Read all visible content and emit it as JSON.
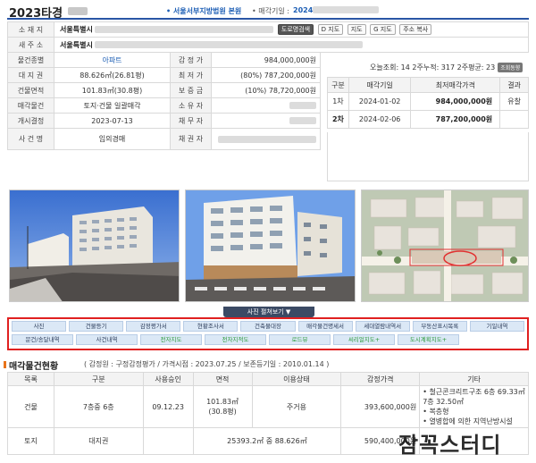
{
  "header": {
    "case_number": "2023타경",
    "court": "• 서울서부지방법원 본원",
    "sale_date_label": "• 매각기일 :",
    "sale_date_value": "2024."
  },
  "info": {
    "location_label": "소 재 지",
    "location_value": "서울특별시",
    "buttons": [
      "도로명검색",
      "D 지도",
      "지도",
      "G 지도",
      "주소 복사"
    ],
    "new_address_label": "새 주 소",
    "new_address_value": "서울특별시",
    "rows": [
      {
        "l1": "물건종별",
        "v1": "아파트",
        "l2": "감 정 가",
        "v2": "984,000,000원"
      },
      {
        "l1": "대 지 권",
        "v1": "88.626㎡(26.81평)",
        "l2": "최 저 가",
        "v2": "(80%) 787,200,000원"
      },
      {
        "l1": "건물면적",
        "v1": "101.83㎡(30.8평)",
        "l2": "보 증 금",
        "v2": "(10%) 78,720,000원"
      },
      {
        "l1": "매각물건",
        "v1": "토지·건물 일괄매각",
        "l2": "소 유 자",
        "v2": ""
      },
      {
        "l1": "개시결정",
        "v1": "2023-07-13",
        "l2": "채 무 자",
        "v2": ""
      },
      {
        "l1": "사 건 명",
        "v1": "임의경매",
        "l2": "채 권 자",
        "v2": ""
      }
    ]
  },
  "stats": {
    "text": "오늘조회: 14  2주누적: 317  2주평균: 23",
    "badge": "조회동향"
  },
  "history": {
    "headers": [
      "구분",
      "매각기일",
      "최저매각가격",
      "결과"
    ],
    "rows": [
      {
        "round": "1차",
        "date": "2024-01-02",
        "price": "984,000,000원",
        "result": "유찰"
      },
      {
        "round": "2차",
        "date": "2024-02-06",
        "price": "787,200,000원",
        "result": ""
      }
    ]
  },
  "photos": {
    "toggle_label": "사진 펼쳐보기 ▼",
    "items": [
      "apartment-street-photo",
      "apartment-crosswalk-photo",
      "aerial-map-photo"
    ]
  },
  "tabs": {
    "row1": [
      "사진",
      "건물등기",
      "감정평가서",
      "현황조사서",
      "건축물대장",
      "매각물건명세서",
      "세대열람내역서",
      "부동산표시목록",
      "기일내역"
    ],
    "row2": [
      "문건/송달내역",
      "사건내역",
      "전자지도",
      "전자지적도",
      "로드뷰",
      "씨리얼지도+",
      "도시계획지도+"
    ],
    "row2_green": [
      false,
      false,
      true,
      true,
      true,
      true,
      true
    ]
  },
  "status_section": {
    "title": "매각물건현황",
    "meta": "( 감정원 : 구정감정평가 / 가격시점 : 2023.07.25 / 보존등기일 : 2010.01.14 )",
    "headers": [
      "목록",
      "구분",
      "사용승인",
      "면적",
      "이용상태",
      "감정가격",
      "기타"
    ],
    "rows": [
      {
        "item": "건물",
        "type": "7층중 6층",
        "approval": "09.12.23",
        "area": "101.83㎡ (30.8평)",
        "usage": "주거용",
        "price": "393,600,000원",
        "notes": [
          "• 철근콘크리트구조 6층 69.33㎡ 7층 32.50㎡",
          "• 복층형",
          "• 열병합에 의한 지역난방시설"
        ]
      },
      {
        "item": "토지",
        "type": "대지권",
        "approval": "",
        "area": "25393.2㎡ 중 88.626㎡",
        "usage": "",
        "price": "590,400,000원",
        "notes": []
      }
    ]
  },
  "watermark": "잠꼭스터디",
  "colors": {
    "accent_blue": "#2a56a5",
    "tab_border": "#e02020",
    "tab_bg": "#dbe8f6"
  }
}
